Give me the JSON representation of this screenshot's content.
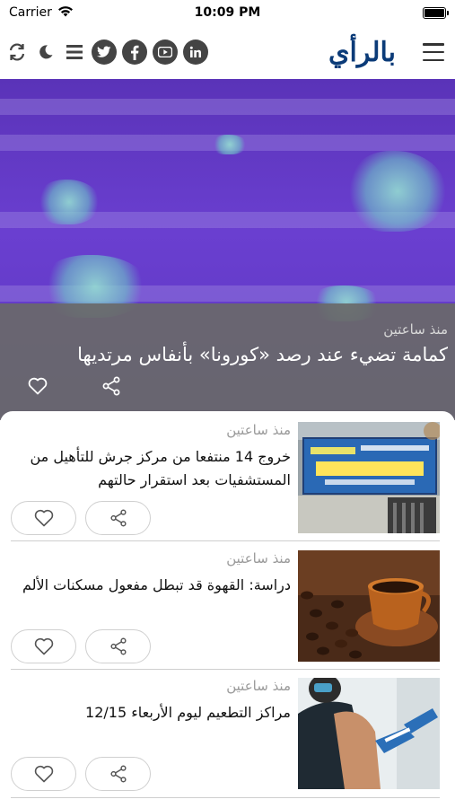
{
  "status_bar": {
    "carrier": "Carrier",
    "time": "10:09 PM",
    "battery_level": 1.0
  },
  "nav": {
    "logo_text": "بالرأي",
    "icons": [
      "refresh-icon",
      "moon-icon",
      "list-icon",
      "twitter-icon",
      "facebook-icon",
      "youtube-icon",
      "linkedin-icon",
      "menu-icon"
    ]
  },
  "hero": {
    "time": "منذ ساعتين",
    "title": "كمامة تضيء عند رصد «كورونا» بأنفاس مرتديها"
  },
  "articles": [
    {
      "time": "منذ ساعتين",
      "title": "خروج 14 منتفعا من مركز جرش للتأهيل من المستشفيات بعد استقرار حالتهم"
    },
    {
      "time": "منذ ساعتين",
      "title": "دراسة: القهوة قد تبطل مفعول مسكنات الألم"
    },
    {
      "time": "منذ ساعتين",
      "title": "مراكز التطعيم ليوم الأربعاء 12/15"
    }
  ],
  "colors": {
    "accent_dark": "#444444",
    "logo_blue": "#0b3b78",
    "logo_green": "#2a8f3c",
    "hero_purple": "#5a33b8",
    "overlay_gray": "#696969"
  }
}
